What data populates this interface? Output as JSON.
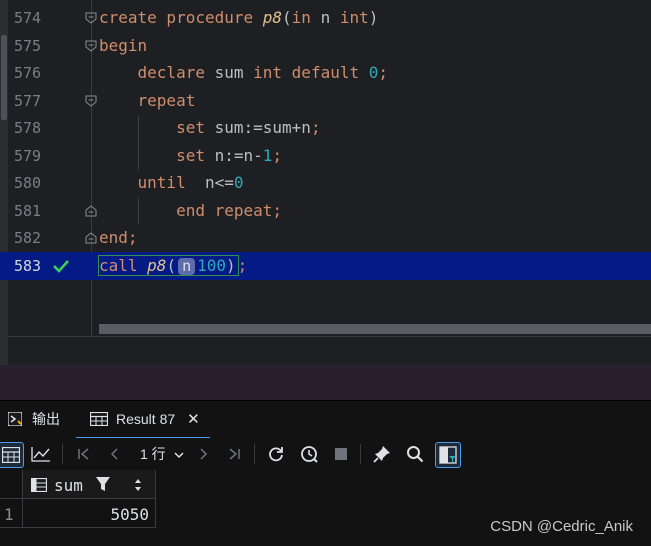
{
  "editor": {
    "lines": [
      {
        "num": "574",
        "tokens": [
          [
            "kw",
            "create procedure "
          ],
          [
            "fn",
            "p8"
          ],
          [
            "ident",
            "("
          ],
          [
            "kw",
            "in"
          ],
          [
            "ident",
            " n "
          ],
          [
            "kw",
            "int"
          ],
          [
            "ident",
            ")"
          ]
        ]
      },
      {
        "num": "575",
        "tokens": [
          [
            "kw",
            "begin"
          ]
        ]
      },
      {
        "num": "576",
        "tokens": [
          [
            "ident",
            "    "
          ],
          [
            "kw",
            "declare"
          ],
          [
            "ident",
            " sum "
          ],
          [
            "kw",
            "int default "
          ],
          [
            "num",
            "0"
          ],
          [
            "kw",
            ";"
          ]
        ]
      },
      {
        "num": "577",
        "tokens": [
          [
            "ident",
            "    "
          ],
          [
            "kw",
            "repeat"
          ]
        ]
      },
      {
        "num": "578",
        "tokens": [
          [
            "ident",
            "        "
          ],
          [
            "kw",
            "set"
          ],
          [
            "ident",
            " sum:=sum+n"
          ],
          [
            "kw",
            ";"
          ]
        ]
      },
      {
        "num": "579",
        "tokens": [
          [
            "ident",
            "        "
          ],
          [
            "kw",
            "set"
          ],
          [
            "ident",
            " n:=n-"
          ],
          [
            "num",
            "1"
          ],
          [
            "kw",
            ";"
          ]
        ]
      },
      {
        "num": "580",
        "tokens": [
          [
            "ident",
            "    "
          ],
          [
            "kw",
            "until"
          ],
          [
            "ident",
            "  n<="
          ],
          [
            "num",
            "0"
          ]
        ]
      },
      {
        "num": "581",
        "tokens": [
          [
            "ident",
            "        "
          ],
          [
            "kw",
            "end repeat;"
          ]
        ]
      },
      {
        "num": "582",
        "tokens": [
          [
            "kw",
            "end;"
          ]
        ]
      },
      {
        "num": "583",
        "call_kw": "call ",
        "call_fn": "p8",
        "call_open": "(",
        "hint": "n",
        "arg": "100",
        "call_close": ")",
        "semi": ";"
      }
    ]
  },
  "tabs": {
    "output_label": "输出",
    "result_label": "Result 87"
  },
  "toolbar": {
    "page_label": "1 行"
  },
  "grid": {
    "column_header": "sum",
    "row_number": "1",
    "cell_value": "5050"
  },
  "watermark": "CSDN @Cedric_Anik",
  "colors": {
    "current_line": "#041a84",
    "keyword": "#cf8e6d",
    "function": "#e2c08d",
    "number": "#2aacb8",
    "active_tab_underline": "#4a9bf0"
  }
}
